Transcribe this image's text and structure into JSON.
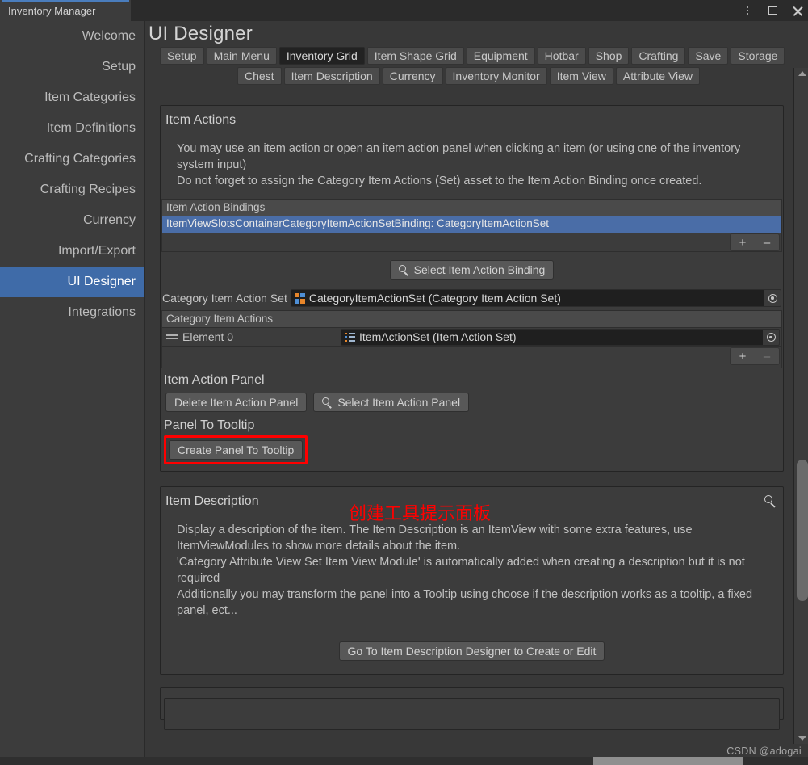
{
  "window": {
    "tab_title": "Inventory Manager",
    "controls": [
      {
        "name": "more-options",
        "glyph": "kebab"
      },
      {
        "name": "maximize",
        "glyph": "square"
      },
      {
        "name": "close",
        "glyph": "x"
      }
    ],
    "accent_color": "#4a7dbd"
  },
  "sidebar": {
    "items": [
      {
        "label": "Welcome",
        "selected": false
      },
      {
        "label": "Setup",
        "selected": false
      },
      {
        "label": "Item Categories",
        "selected": false
      },
      {
        "label": "Item Definitions",
        "selected": false
      },
      {
        "label": "Crafting Categories",
        "selected": false
      },
      {
        "label": "Crafting Recipes",
        "selected": false
      },
      {
        "label": "Currency",
        "selected": false
      },
      {
        "label": "Import/Export",
        "selected": false
      },
      {
        "label": "UI Designer",
        "selected": true
      },
      {
        "label": "Integrations",
        "selected": false
      }
    ],
    "selected_color": "#3f6ba8"
  },
  "page": {
    "title": "UI Designer"
  },
  "tabs_row1": [
    {
      "label": "Setup",
      "active": false
    },
    {
      "label": "Main Menu",
      "active": false
    },
    {
      "label": "Inventory Grid",
      "active": true
    },
    {
      "label": "Item Shape Grid",
      "active": false
    },
    {
      "label": "Equipment",
      "active": false
    },
    {
      "label": "Hotbar",
      "active": false
    },
    {
      "label": "Shop",
      "active": false
    },
    {
      "label": "Crafting",
      "active": false
    },
    {
      "label": "Save",
      "active": false
    },
    {
      "label": "Storage",
      "active": false
    }
  ],
  "tabs_row2": [
    {
      "label": "Chest",
      "active": false
    },
    {
      "label": "Item Description",
      "active": false
    },
    {
      "label": "Currency",
      "active": false
    },
    {
      "label": "Inventory Monitor",
      "active": false
    },
    {
      "label": "Item View",
      "active": false
    },
    {
      "label": "Attribute View",
      "active": false
    }
  ],
  "item_actions": {
    "title": "Item Actions",
    "help": "You may use an item action or open an item action panel when clicking an item (or using one of the inventory system input)\nDo not forget to assign the Category Item Actions (Set) asset to the Item Action Binding once created.",
    "bindings_header": "Item Action Bindings",
    "bindings": [
      {
        "label": "ItemViewSlotsContainerCategoryItemActionSetBinding: CategoryItemActionSet",
        "selected": true
      }
    ],
    "add_label": "+",
    "remove_label": "–",
    "select_binding_button": "Select Item Action Binding",
    "category_set_label": "Category Item Action Set",
    "category_set_value": "CategoryItemActionSet (Category Item Action Set)",
    "category_actions_header": "Category Item Actions",
    "elements": [
      {
        "label": "Element 0",
        "value": "ItemActionSet (Item Action Set)"
      }
    ]
  },
  "item_action_panel": {
    "title": "Item Action Panel",
    "delete_button": "Delete Item Action Panel",
    "select_button": "Select Item Action Panel"
  },
  "panel_to_tooltip": {
    "title": "Panel To Tooltip",
    "create_button": "Create Panel To Tooltip",
    "annotation": "创建工具提示面板",
    "annotation_color": "#ff0000",
    "highlight_color": "#ff0000"
  },
  "item_description": {
    "title": "Item Description",
    "search_icon": "search-icon",
    "help": "Display a description of the item. The Item Description is an ItemView with some extra features, use ItemViewModules to show more details about the item.\n'Category Attribute View Set Item View Module' is automatically added when creating a description but it is not required\nAdditionally you may transform the panel into a Tooltip using choose if the description works as a tooltip, a fixed panel, ect...",
    "go_to_button": "Go To Item Description Designer to Create or Edit"
  },
  "scrollbar": {
    "up_arrow": "scroll-up-arrow",
    "down_arrow": "scroll-down-arrow"
  },
  "watermark": "CSDN @adogai"
}
